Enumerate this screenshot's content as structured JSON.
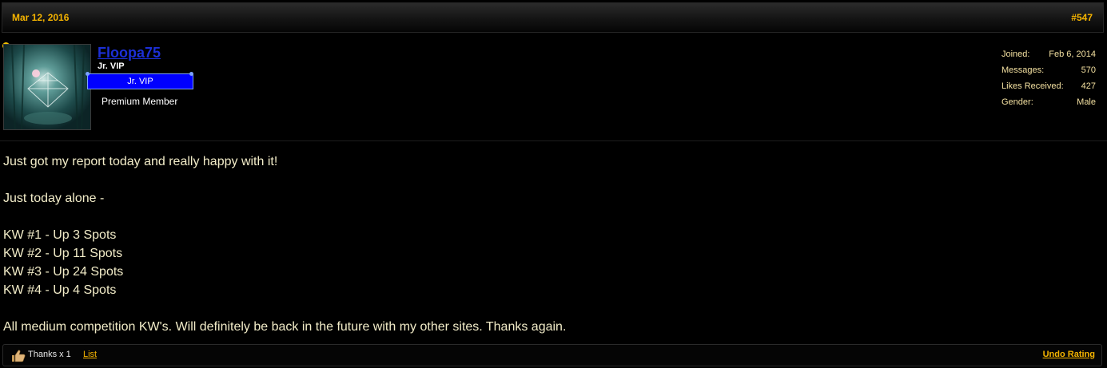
{
  "post": {
    "date": "Mar 12, 2016",
    "number": "#547"
  },
  "user": {
    "name": "Floopa75",
    "title": "Jr. VIP",
    "rank": "Jr. VIP",
    "membership": "Premium Member",
    "online_color": "#f5c400"
  },
  "stats": [
    {
      "label": "Joined:",
      "value": "Feb 6, 2014"
    },
    {
      "label": "Messages:",
      "value": "570"
    },
    {
      "label": "Likes Received:",
      "value": "427"
    },
    {
      "label": "Gender:",
      "value": "Male"
    }
  ],
  "message": {
    "lines": [
      "Just got my report today and really happy with it!",
      "",
      "Just today alone -",
      "",
      "KW #1 - Up 3 Spots",
      "KW #2 - Up 11 Spots",
      "KW #3 - Up 24 Spots",
      "KW #4 - Up 4 Spots",
      "",
      "All medium competition KW's. Will definitely be back in the future with my other sites. Thanks again."
    ]
  },
  "footer": {
    "thanks": "Thanks x 1",
    "list_label": "List",
    "undo_label": "Undo Rating",
    "icon": "thumbs-up-icon"
  },
  "colors": {
    "accent": "#f5b400",
    "username": "#1c2fd6",
    "rank_bg": "#0000ff",
    "message_text": "#f2ecc8"
  }
}
